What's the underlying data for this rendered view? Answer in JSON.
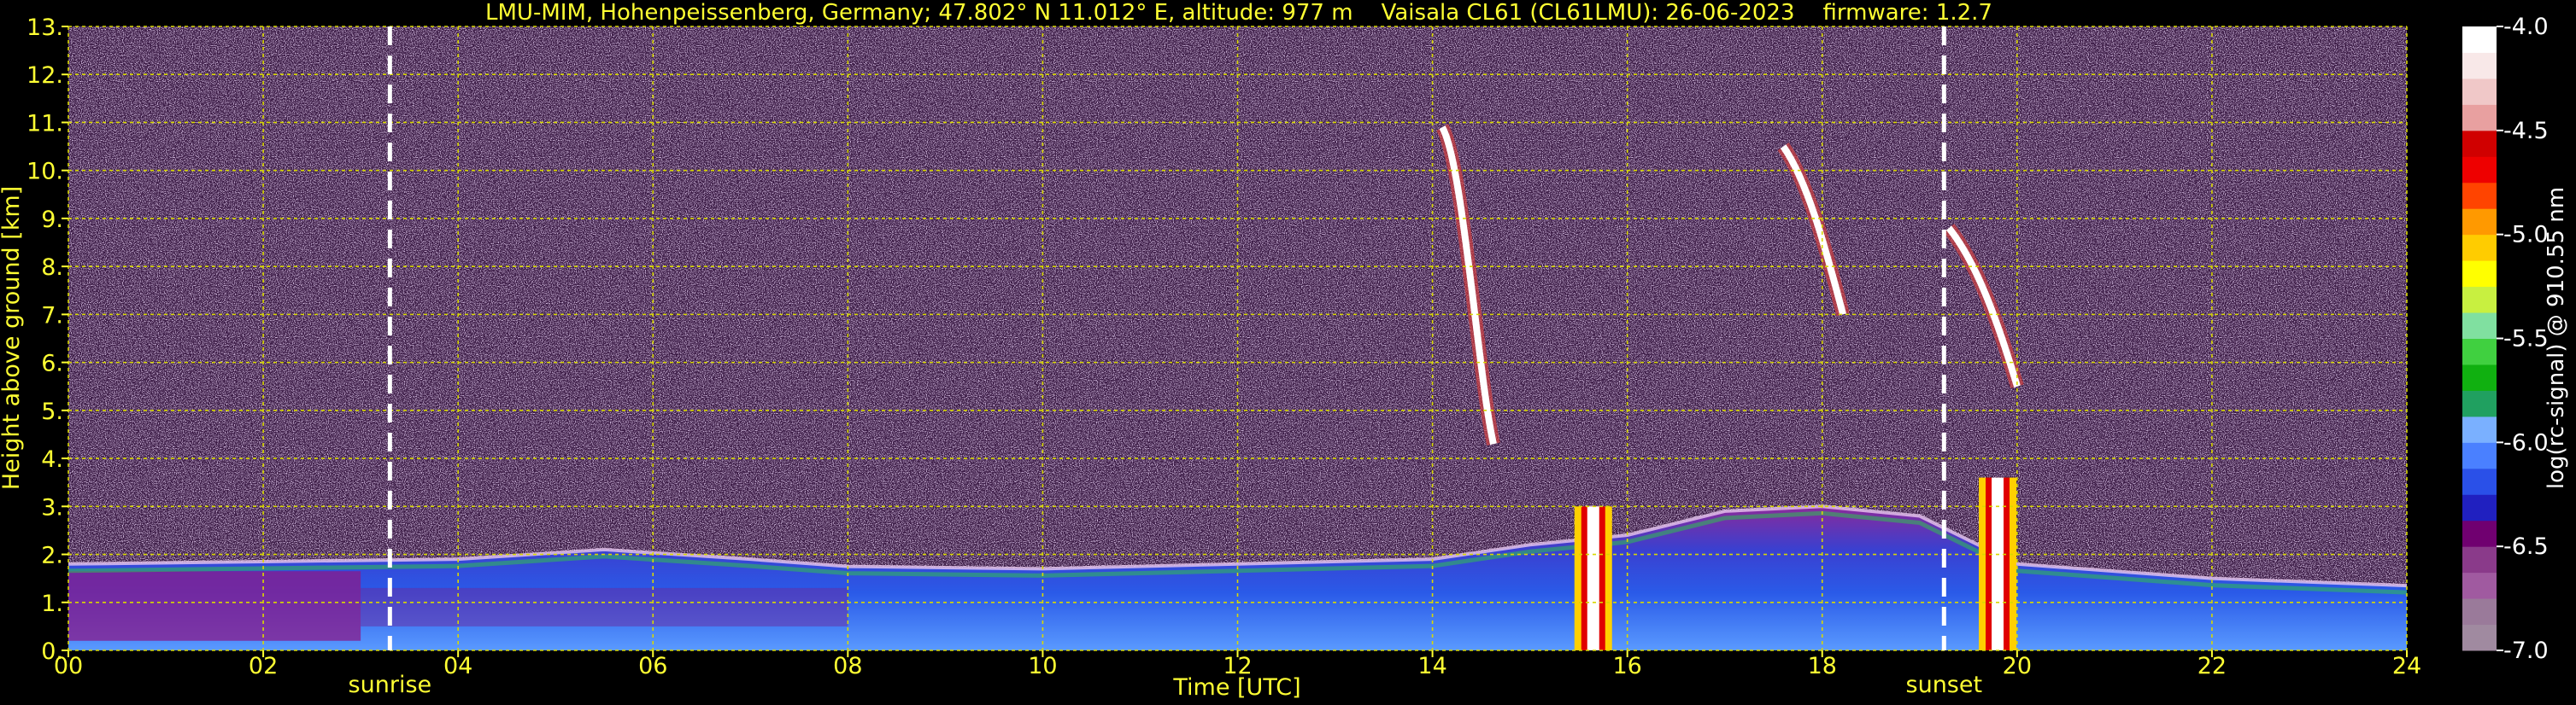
{
  "chart_data": {
    "type": "heatmap",
    "title": "LMU-MIM, Hohenpeissenberg, Germany; 47.802° N 11.012° E, altitude: 977 m    Vaisala CL61 (CL61LMU): 26-06-2023    firmware: 1.2.7",
    "xlabel": "Time [UTC]",
    "ylabel": "Height above ground [km]",
    "xlim": [
      0,
      24
    ],
    "ylim": [
      0,
      13
    ],
    "x_ticks": [
      "00",
      "02",
      "04",
      "06",
      "08",
      "10",
      "12",
      "14",
      "16",
      "18",
      "20",
      "22",
      "24"
    ],
    "y_ticks": [
      "0.",
      "1.",
      "2.",
      "3.",
      "4.",
      "5.",
      "6.",
      "7.",
      "8.",
      "9.",
      "10.",
      "11.",
      "12.",
      "13."
    ],
    "grid": true,
    "colorbar": {
      "label": "log(rc-signal) @ 910.55 nm",
      "range": [
        -7.0,
        -4.0
      ],
      "ticks": [
        "-4.0",
        "-4.5",
        "-5.0",
        "-5.5",
        "-6.0",
        "-6.5",
        "-7.0"
      ],
      "colors": [
        "#a08aa0",
        "#9a7a9a",
        "#a05aa0",
        "#8a3a8a",
        "#700070",
        "#2020c0",
        "#2a50e8",
        "#4a80ff",
        "#7ab0ff",
        "#20a060",
        "#10b010",
        "#40d040",
        "#80e0a0",
        "#c8f040",
        "#ffff00",
        "#ffcc00",
        "#ff9900",
        "#ff4400",
        "#ee0000",
        "#d00000",
        "#e8a0a0",
        "#f0c8c8",
        "#f8e8e8",
        "#ffffff"
      ]
    },
    "markers": [
      {
        "label": "sunrise",
        "x": 3.3
      },
      {
        "label": "sunset",
        "x": 19.25
      }
    ],
    "features": {
      "boundary_layer_top_km": [
        {
          "t": 0,
          "h": 1.8
        },
        {
          "t": 2,
          "h": 1.85
        },
        {
          "t": 4,
          "h": 1.9
        },
        {
          "t": 5.5,
          "h": 2.1
        },
        {
          "t": 7,
          "h": 1.9
        },
        {
          "t": 8,
          "h": 1.75
        },
        {
          "t": 10,
          "h": 1.7
        },
        {
          "t": 12,
          "h": 1.8
        },
        {
          "t": 14,
          "h": 1.9
        },
        {
          "t": 15,
          "h": 2.2
        },
        {
          "t": 16,
          "h": 2.4
        },
        {
          "t": 17,
          "h": 2.9
        },
        {
          "t": 18,
          "h": 3.0
        },
        {
          "t": 19,
          "h": 2.8
        },
        {
          "t": 20,
          "h": 1.8
        },
        {
          "t": 22,
          "h": 1.5
        },
        {
          "t": 24,
          "h": 1.35
        }
      ],
      "cirrus": [
        {
          "t": 14.1,
          "h_top": 10.9,
          "h_bottom": 4.3
        },
        {
          "t": 17.6,
          "h_top": 10.5,
          "h_bottom": 7.0
        },
        {
          "t": 19.3,
          "h_top": 8.8,
          "h_bottom": 5.5
        }
      ],
      "precip_columns": [
        {
          "t": 15.65,
          "h_top": 3.0
        },
        {
          "t": 19.8,
          "h_top": 3.6
        }
      ]
    }
  }
}
